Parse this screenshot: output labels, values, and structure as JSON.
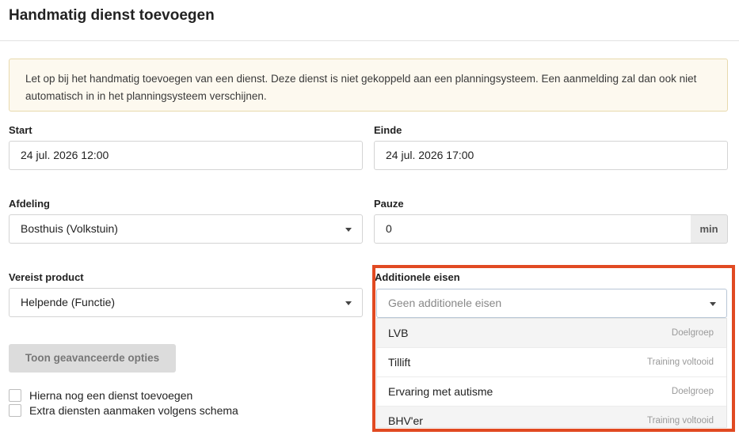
{
  "modal": {
    "title": "Handmatig dienst toevoegen",
    "notice": "Let op bij het handmatig toevoegen van een dienst. Deze dienst is niet gekoppeld aan een planningsysteem. Een aanmelding zal dan ook niet automatisch in in het planningsysteem verschijnen."
  },
  "form": {
    "start": {
      "label": "Start",
      "value": "24 jul. 2026 12:00"
    },
    "end": {
      "label": "Einde",
      "value": "24 jul. 2026 17:00"
    },
    "department": {
      "label": "Afdeling",
      "value": "Bosthuis (Volkstuin)"
    },
    "break": {
      "label": "Pauze",
      "value": "0",
      "unit": "min"
    },
    "product": {
      "label": "Vereist product",
      "value": "Helpende (Functie)"
    },
    "requirements": {
      "label": "Additionele eisen",
      "placeholder": "Geen additionele eisen",
      "options": [
        {
          "name": "LVB",
          "tag": "Doelgroep"
        },
        {
          "name": "Tillift",
          "tag": "Training voltooid"
        },
        {
          "name": "Ervaring met autisme",
          "tag": "Doelgroep"
        },
        {
          "name": "BHV'er",
          "tag": "Training voltooid"
        }
      ]
    },
    "advanced_button": "Toon geavanceerde opties",
    "checkboxes": [
      {
        "label": "Hierna nog een dienst toevoegen"
      },
      {
        "label": "Extra diensten aanmaken volgens schema"
      }
    ]
  },
  "colors": {
    "highlight": "#e14a22",
    "notice_bg": "#fdf9ef",
    "notice_border": "#e8d9ad"
  }
}
